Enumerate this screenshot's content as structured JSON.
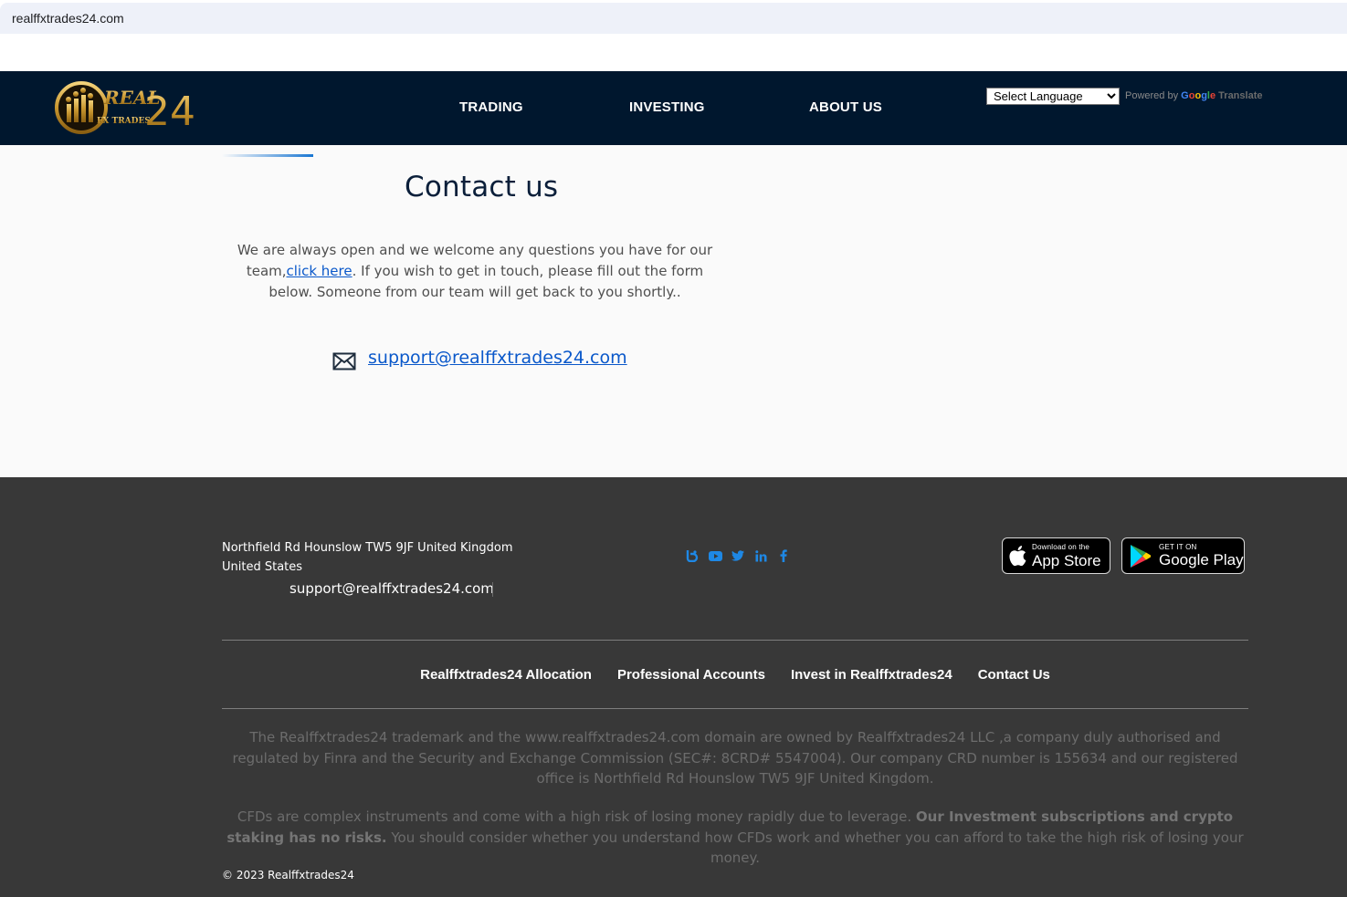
{
  "browser": {
    "url": "realffxtrades24.com"
  },
  "header": {
    "logo_text": "REAL FX TRADES 24",
    "nav": [
      "TRADING",
      "INVESTING",
      "ABOUT US"
    ],
    "language_select": "Select Language",
    "powered_by": "Powered by",
    "google": "Google",
    "translate": "Translate"
  },
  "main": {
    "title": "Contact us",
    "intro_before": "We are always open and we welcome any questions you have for our team,",
    "intro_link": "click here",
    "intro_after": ". If you wish to get in touch, please fill out the form below. Someone from our team will get back to you shortly..",
    "email": "support@realffxtrades24.com",
    "email_icon": "envelope-icon"
  },
  "footer": {
    "address_line1": "Northfield Rd Hounslow TW5 9JF United Kingdom",
    "address_line2": "United States",
    "email": "support@realffxtrades24.com",
    "social_icons": [
      "blog-icon",
      "youtube-icon",
      "twitter-icon",
      "linkedin-icon",
      "facebook-icon"
    ],
    "app_store": {
      "small": "Download on the",
      "big": "App Store"
    },
    "google_play": {
      "small": "GET IT ON",
      "big": "Google Play"
    },
    "links": [
      "Realffxtrades24 Allocation",
      "Professional Accounts",
      "Invest in Realffxtrades24",
      "Contact Us"
    ],
    "legal1": "The Realffxtrades24 trademark and the www.realffxtrades24.com domain are owned by Realffxtrades24 LLC ,a company duly authorised and regulated by Finra and the Security and Exchange Commission (SEC#: 8CRD# 5547004). Our company CRD number is 155634 and our registered office is Northfield Rd Hounslow TW5 9JF United Kingdom.",
    "legal2_before": "CFDs are complex instruments and come with a high risk of losing money rapidly due to leverage. ",
    "legal2_bold": "Our Investment subscriptions and crypto staking has no risks.",
    "legal2_after": " You should consider whether you understand how CFDs work and whether you can afford to take the high risk of losing your money.",
    "copyright": "© 2023 Realffxtrades24"
  },
  "colors": {
    "nav_bg": "#00172e",
    "footer_bg": "#383838",
    "link": "#0a58ca",
    "social": "#1e88e5"
  }
}
